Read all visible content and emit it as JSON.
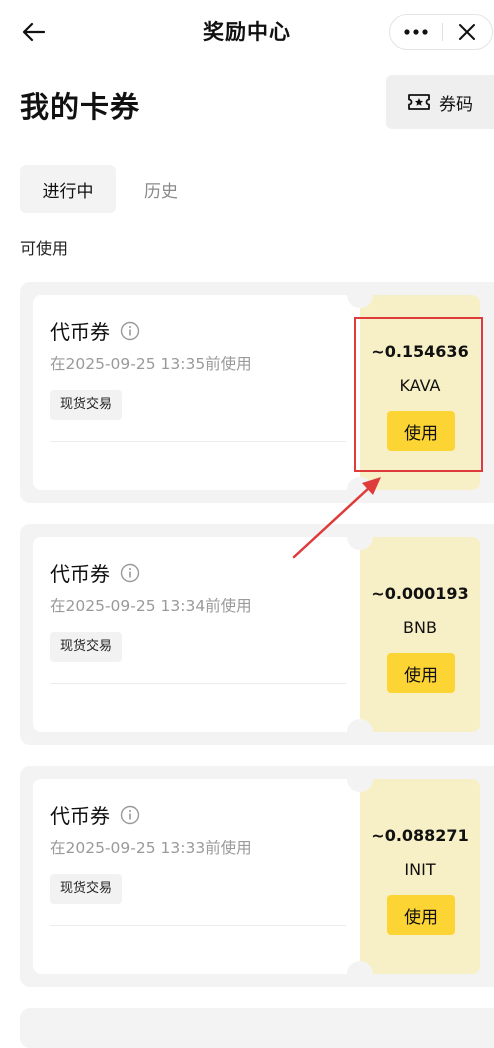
{
  "header": {
    "title": "奖励中心",
    "more_icon": "more-dots-icon",
    "close_icon": "close-icon",
    "back_icon": "back-arrow-icon"
  },
  "page": {
    "title": "我的卡券",
    "code_button_label": "券码",
    "code_button_icon": "ticket-star-icon"
  },
  "tabs": [
    {
      "label": "进行中",
      "active": true
    },
    {
      "label": "历史",
      "active": false
    }
  ],
  "section_label": "可使用",
  "coupons": [
    {
      "title": "代币券",
      "expiry": "在2025-09-25 13:35前使用",
      "tag": "现货交易",
      "amount": "~0.154636",
      "token": "KAVA",
      "use_label": "使用"
    },
    {
      "title": "代币券",
      "expiry": "在2025-09-25 13:34前使用",
      "tag": "现货交易",
      "amount": "~0.000193",
      "token": "BNB",
      "use_label": "使用"
    },
    {
      "title": "代币券",
      "expiry": "在2025-09-25 13:33前使用",
      "tag": "现货交易",
      "amount": "~0.088271",
      "token": "INIT",
      "use_label": "使用"
    }
  ],
  "colors": {
    "accent": "#fcd535",
    "coupon_bg": "#f7f0c6",
    "annotation": "#e03b3b"
  }
}
